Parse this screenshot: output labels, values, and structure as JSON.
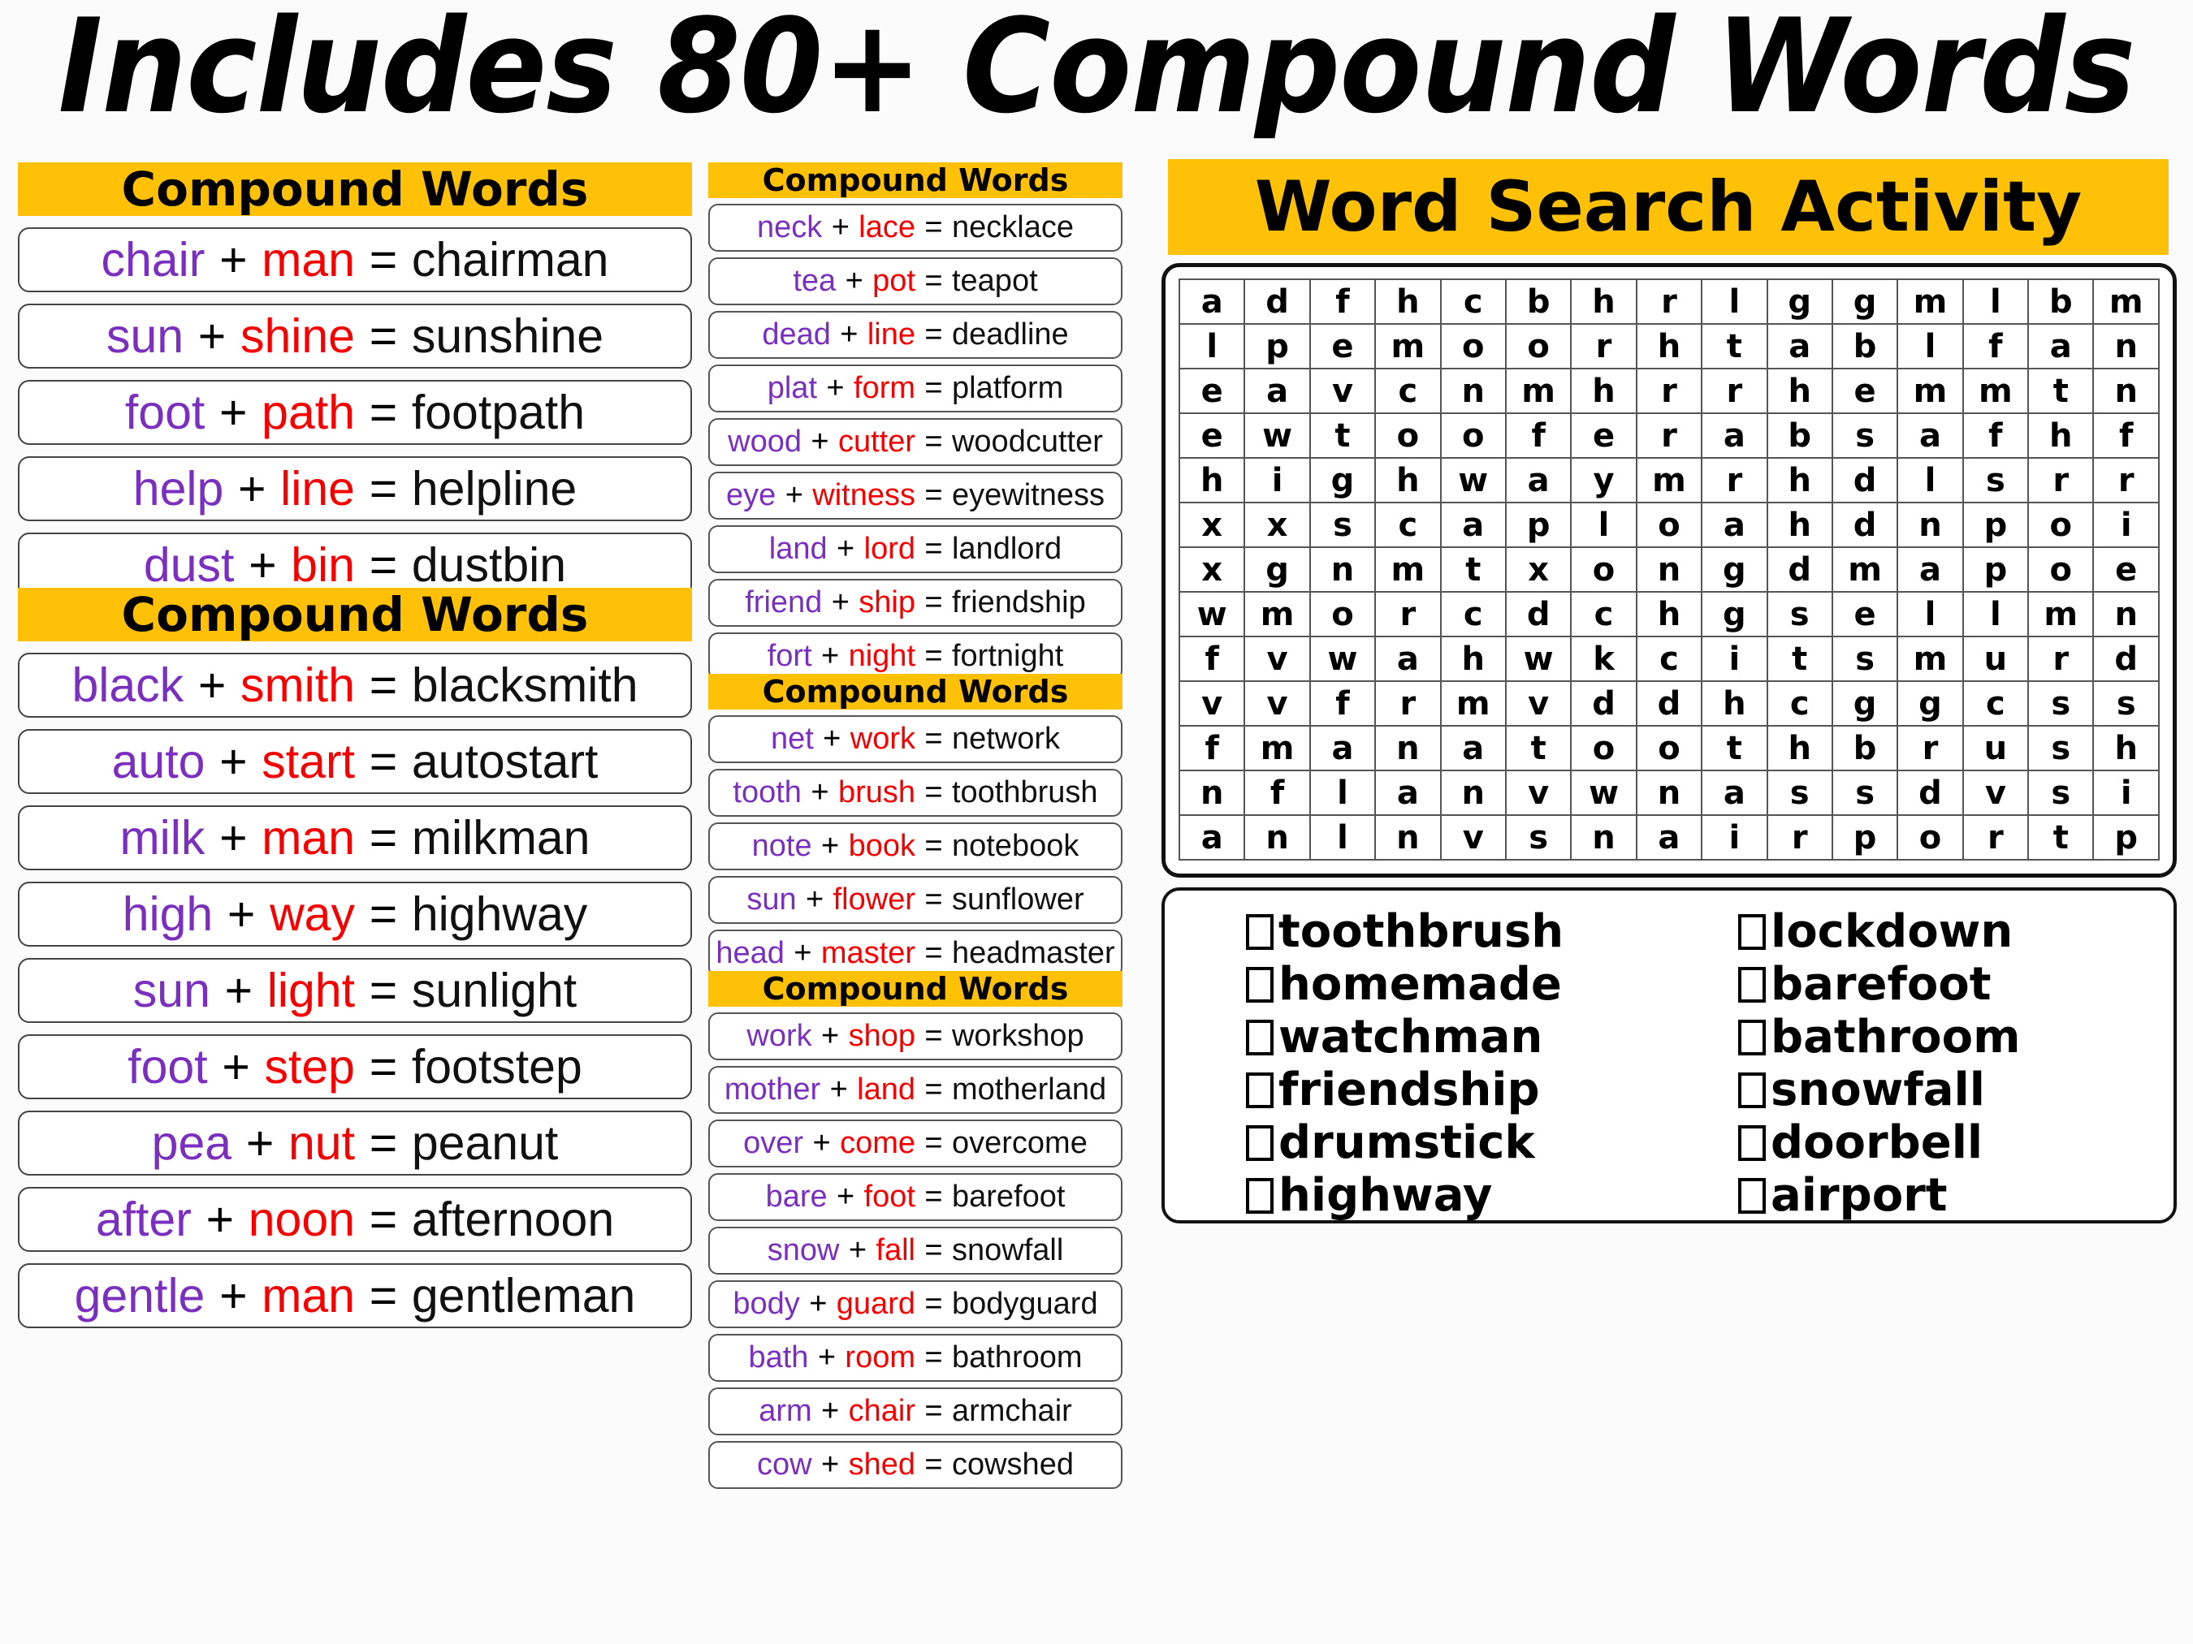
{
  "title": "Includes 80+ Compound Words",
  "colors": {
    "accent_yellow": "#FFC008",
    "word1": "#7A2FBF",
    "word2": "#F40000",
    "result": "#111111"
  },
  "left_column": {
    "header1": "Compound Words",
    "group1": [
      {
        "w1": "chair",
        "w2": "man",
        "result": "chairman"
      },
      {
        "w1": "sun",
        "w2": "shine",
        "result": "sunshine"
      },
      {
        "w1": "foot",
        "w2": "path",
        "result": "footpath"
      },
      {
        "w1": "help",
        "w2": "line",
        "result": "helpline"
      },
      {
        "w1": "dust",
        "w2": "bin",
        "result": "dustbin"
      }
    ],
    "header2": "Compound Words",
    "group2": [
      {
        "w1": "black",
        "w2": "smith",
        "result": "blacksmith"
      },
      {
        "w1": "auto",
        "w2": "start",
        "result": "autostart"
      },
      {
        "w1": "milk",
        "w2": "man",
        "result": "milkman"
      },
      {
        "w1": "high",
        "w2": "way",
        "result": "highway"
      },
      {
        "w1": "sun",
        "w2": "light",
        "result": "sunlight"
      },
      {
        "w1": "foot",
        "w2": "step",
        "result": "footstep"
      },
      {
        "w1": "pea",
        "w2": "nut",
        "result": "peanut"
      },
      {
        "w1": "after",
        "w2": "noon",
        "result": "afternoon"
      },
      {
        "w1": "gentle",
        "w2": "man",
        "result": "gentleman"
      }
    ]
  },
  "middle_column": {
    "header1": "Compound Words",
    "group1": [
      {
        "w1": "neck",
        "w2": "lace",
        "result": "necklace"
      },
      {
        "w1": "tea",
        "w2": "pot",
        "result": "teapot"
      },
      {
        "w1": "dead",
        "w2": "line",
        "result": "deadline"
      },
      {
        "w1": "plat",
        "w2": "form",
        "result": "platform"
      },
      {
        "w1": "wood",
        "w2": "cutter",
        "result": "woodcutter"
      },
      {
        "w1": "eye",
        "w2": "witness",
        "result": "eyewitness"
      },
      {
        "w1": "land",
        "w2": "lord",
        "result": "landlord"
      },
      {
        "w1": "friend",
        "w2": "ship",
        "result": "friendship"
      },
      {
        "w1": "fort",
        "w2": "night",
        "result": "fortnight"
      }
    ],
    "header2": "Compound Words",
    "group2": [
      {
        "w1": "net",
        "w2": "work",
        "result": "network"
      },
      {
        "w1": "tooth",
        "w2": "brush",
        "result": "toothbrush"
      },
      {
        "w1": "note",
        "w2": "book",
        "result": "notebook"
      },
      {
        "w1": "sun",
        "w2": "flower",
        "result": "sunflower"
      },
      {
        "w1": "head",
        "w2": "master",
        "result": "headmaster"
      }
    ],
    "header3": "Compound Words",
    "group3": [
      {
        "w1": "work",
        "w2": "shop",
        "result": "workshop"
      },
      {
        "w1": "mother",
        "w2": "land",
        "result": "motherland"
      },
      {
        "w1": "over",
        "w2": "come",
        "result": "overcome"
      },
      {
        "w1": "bare",
        "w2": "foot",
        "result": "barefoot"
      },
      {
        "w1": "snow",
        "w2": "fall",
        "result": "snowfall"
      },
      {
        "w1": "body",
        "w2": "guard",
        "result": "bodyguard"
      },
      {
        "w1": "bath",
        "w2": "room",
        "result": "bathroom"
      },
      {
        "w1": "arm",
        "w2": "chair",
        "result": "armchair"
      },
      {
        "w1": "cow",
        "w2": "shed",
        "result": "cowshed"
      }
    ]
  },
  "word_search": {
    "header": "Word Search Activity",
    "grid": [
      [
        "a",
        "d",
        "f",
        "h",
        "c",
        "b",
        "h",
        "r",
        "l",
        "g",
        "g",
        "m",
        "l",
        "b",
        "m"
      ],
      [
        "l",
        "p",
        "e",
        "m",
        "o",
        "o",
        "r",
        "h",
        "t",
        "a",
        "b",
        "l",
        "f",
        "a",
        "n"
      ],
      [
        "e",
        "a",
        "v",
        "c",
        "n",
        "m",
        "h",
        "r",
        "r",
        "h",
        "e",
        "m",
        "m",
        "t",
        "n"
      ],
      [
        "e",
        "w",
        "t",
        "o",
        "o",
        "f",
        "e",
        "r",
        "a",
        "b",
        "s",
        "a",
        "f",
        "h",
        "f"
      ],
      [
        "h",
        "i",
        "g",
        "h",
        "w",
        "a",
        "y",
        "m",
        "r",
        "h",
        "d",
        "l",
        "s",
        "r",
        "r"
      ],
      [
        "x",
        "x",
        "s",
        "c",
        "a",
        "p",
        "l",
        "o",
        "a",
        "h",
        "d",
        "n",
        "p",
        "o",
        "i"
      ],
      [
        "x",
        "g",
        "n",
        "m",
        "t",
        "x",
        "o",
        "n",
        "g",
        "d",
        "m",
        "a",
        "p",
        "o",
        "e"
      ],
      [
        "w",
        "m",
        "o",
        "r",
        "c",
        "d",
        "c",
        "h",
        "g",
        "s",
        "e",
        "l",
        "l",
        "m",
        "n"
      ],
      [
        "f",
        "v",
        "w",
        "a",
        "h",
        "w",
        "k",
        "c",
        "i",
        "t",
        "s",
        "m",
        "u",
        "r",
        "d"
      ],
      [
        "v",
        "v",
        "f",
        "r",
        "m",
        "v",
        "d",
        "d",
        "h",
        "c",
        "g",
        "g",
        "c",
        "s",
        "s"
      ],
      [
        "f",
        "m",
        "a",
        "n",
        "a",
        "t",
        "o",
        "o",
        "t",
        "h",
        "b",
        "r",
        "u",
        "s",
        "h"
      ],
      [
        "n",
        "f",
        "l",
        "a",
        "n",
        "v",
        "w",
        "n",
        "a",
        "s",
        "s",
        "d",
        "v",
        "s",
        "i"
      ],
      [
        "a",
        "n",
        "l",
        "n",
        "v",
        "s",
        "n",
        "a",
        "i",
        "r",
        "p",
        "o",
        "r",
        "t",
        "p"
      ]
    ],
    "word_list_left": [
      "toothbrush",
      "homemade",
      "watchman",
      "friendship",
      "drumstick",
      "highway"
    ],
    "word_list_right": [
      "lockdown",
      "barefoot",
      "bathroom",
      "snowfall",
      "doorbell",
      "airport"
    ]
  }
}
